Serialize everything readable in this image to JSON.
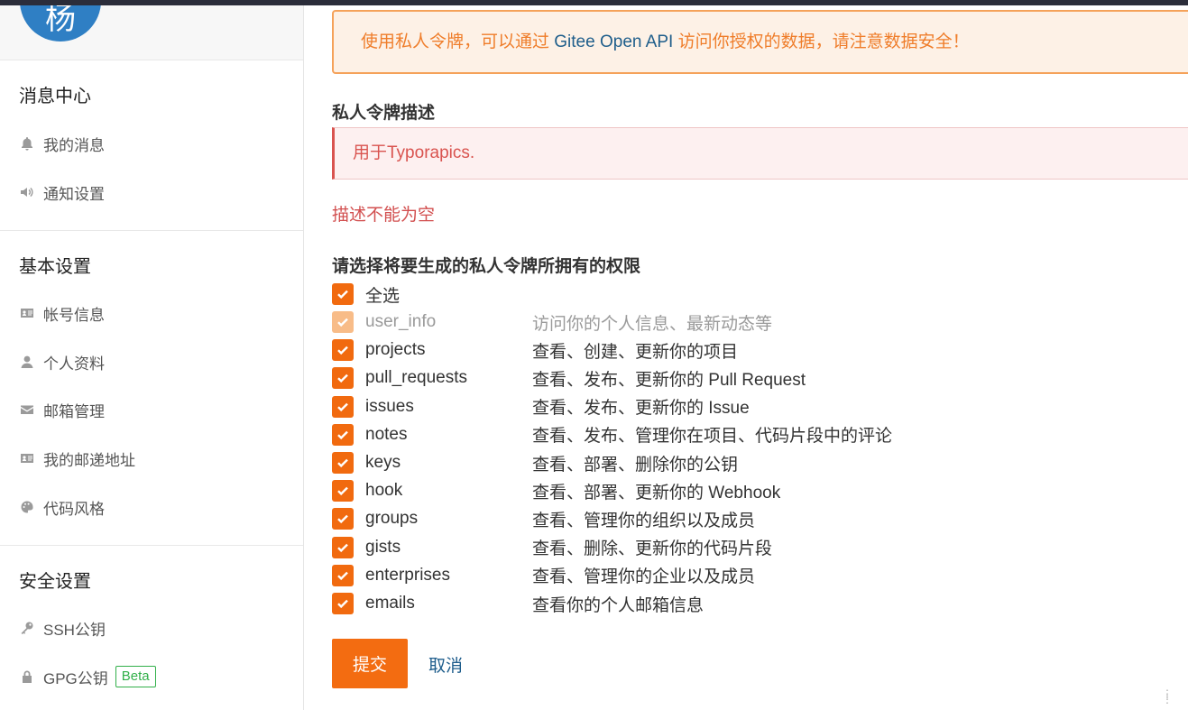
{
  "sidebar": {
    "avatar_text": "杨",
    "sections": [
      {
        "title": "消息中心",
        "items": [
          {
            "label": "我的消息",
            "icon": "bell-icon"
          },
          {
            "label": "通知设置",
            "icon": "speaker-icon"
          }
        ]
      },
      {
        "title": "基本设置",
        "items": [
          {
            "label": "帐号信息",
            "icon": "id-card-icon"
          },
          {
            "label": "个人资料",
            "icon": "user-icon"
          },
          {
            "label": "邮箱管理",
            "icon": "envelope-icon"
          },
          {
            "label": "我的邮递地址",
            "icon": "address-card-icon"
          },
          {
            "label": "代码风格",
            "icon": "palette-icon"
          }
        ]
      },
      {
        "title": "安全设置",
        "items": [
          {
            "label": "SSH公钥",
            "icon": "key-icon"
          },
          {
            "label": "GPG公钥",
            "icon": "lock-icon",
            "badge": "Beta"
          }
        ]
      }
    ]
  },
  "main": {
    "alert": {
      "prefix": "使用私人令牌，可以通过 ",
      "api": "Gitee Open API",
      "suffix": " 访问你授权的数据，请注意数据安全！"
    },
    "desc_label": "私人令牌描述",
    "desc_value": "用于Typorapics.",
    "desc_error": "描述不能为空",
    "perm_label": "请选择将要生成的私人令牌所拥有的权限",
    "select_all": "全选",
    "permissions": [
      {
        "name": "user_info",
        "desc": "访问你的个人信息、最新动态等",
        "disabled": true
      },
      {
        "name": "projects",
        "desc": "查看、创建、更新你的项目"
      },
      {
        "name": "pull_requests",
        "desc": "查看、发布、更新你的 Pull Request"
      },
      {
        "name": "issues",
        "desc": "查看、发布、更新你的 Issue"
      },
      {
        "name": "notes",
        "desc": "查看、发布、管理你在项目、代码片段中的评论"
      },
      {
        "name": "keys",
        "desc": "查看、部署、删除你的公钥"
      },
      {
        "name": "hook",
        "desc": "查看、部署、更新你的 Webhook"
      },
      {
        "name": "groups",
        "desc": "查看、管理你的组织以及成员"
      },
      {
        "name": "gists",
        "desc": "查看、删除、更新你的代码片段"
      },
      {
        "name": "enterprises",
        "desc": "查看、管理你的企业以及成员"
      },
      {
        "name": "emails",
        "desc": "查看你的个人邮箱信息"
      }
    ],
    "submit_label": "提交",
    "cancel_label": "取消"
  },
  "colors": {
    "accent": "#f36c11",
    "error": "#d24f4f",
    "link": "#1e5d8c",
    "beta": "#32b04a"
  }
}
